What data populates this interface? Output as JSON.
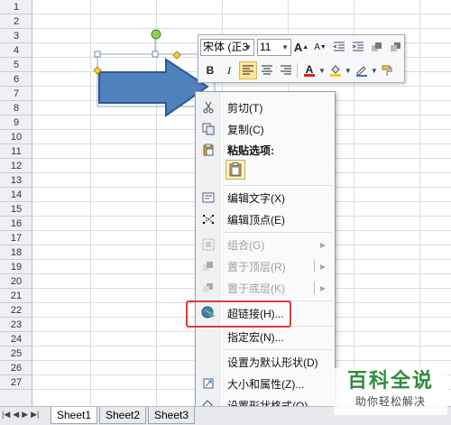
{
  "row_numbers": [
    "1",
    "2",
    "3",
    "4",
    "5",
    "6",
    "7",
    "8",
    "9",
    "10",
    "11",
    "12",
    "13",
    "14",
    "15",
    "16",
    "17",
    "18",
    "19",
    "20",
    "21",
    "22",
    "23",
    "24",
    "25",
    "26",
    "27"
  ],
  "mini_toolbar": {
    "font_name": "宋体 (正3",
    "font_size": "11",
    "grow_font": "A",
    "shrink_font": "A",
    "bold": "B",
    "italic": "I",
    "font_color_letter": "A"
  },
  "context_menu": {
    "cut": "剪切(T)",
    "copy": "复制(C)",
    "paste_options": "粘贴选项:",
    "edit_text": "编辑文字(X)",
    "edit_points": "编辑顶点(E)",
    "group": "组合(G)",
    "bring_to_front": "置于顶层(R)",
    "send_to_back": "置于底层(K)",
    "hyperlink": "超链接(H)...",
    "assign_macro": "指定宏(N)...",
    "set_default_shape": "设置为默认形状(D)",
    "size_properties": "大小和属性(Z)...",
    "format_shape": "设置形状格式(O)..."
  },
  "sheet_tabs": [
    "Sheet1",
    "Sheet2",
    "Sheet3"
  ],
  "watermark": {
    "title": "百科全说",
    "subtitle": "助你轻松解决"
  },
  "colors": {
    "shape_fill": "#4f81bd",
    "shape_outline": "#2c5b8f",
    "highlight_box": "#e03a3a",
    "watermark_green": "#2e8b3e"
  }
}
